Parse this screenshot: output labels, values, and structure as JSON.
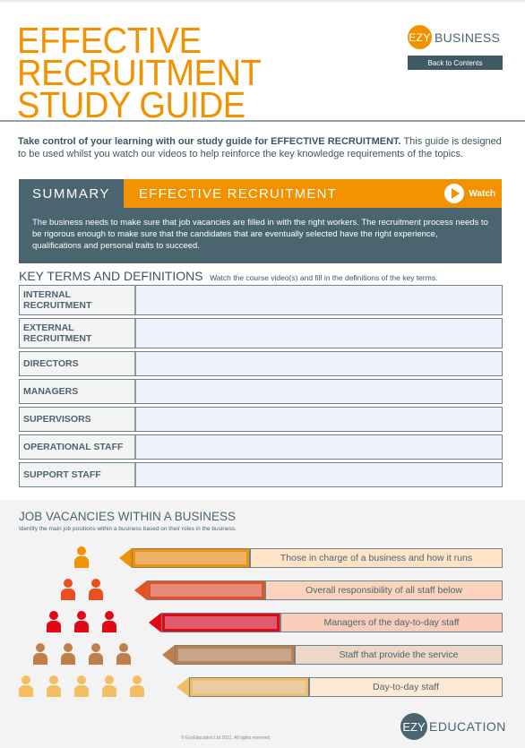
{
  "header": {
    "title_lines": [
      "EFFECTIVE",
      "RECRUITMENT",
      "STUDY GUIDE"
    ],
    "brand_badge": "EZY",
    "brand_name": "BUSINESS",
    "back_button": "Back to Contents"
  },
  "intro": {
    "bold": "Take control of your learning with our study guide for EFFECTIVE RECRUITMENT.",
    "rest": " This guide is designed to be used whilst you watch our videos to help reinforce the key knowledge requirements of the topics."
  },
  "summary": {
    "tab_label": "SUMMARY",
    "heading": "EFFECTIVE RECRUITMENT",
    "watch_label": "Watch",
    "body": "The business needs to make sure that job vacancies are filled in with the right workers. The recruitment process needs to be rigorous enough to make sure that the candidates that are eventually selected have the right experience, qualifications and personal traits to succeed."
  },
  "key_terms": {
    "title": "KEY TERMS AND DEFINITIONS",
    "instruction": "Watch the course video(s) and fill in the definitions of the key terms.",
    "rows": [
      {
        "term": "INTERNAL RECRUITMENT",
        "definition": ""
      },
      {
        "term": "EXTERNAL RECRUITMENT",
        "definition": ""
      },
      {
        "term": "DIRECTORS",
        "definition": ""
      },
      {
        "term": "MANAGERS",
        "definition": ""
      },
      {
        "term": "SUPERVISORS",
        "definition": ""
      },
      {
        "term": "OPERATIONAL STAFF",
        "definition": ""
      },
      {
        "term": "SUPPORT STAFF",
        "definition": ""
      }
    ]
  },
  "job_vacancies": {
    "title": "JOB VACANCIES WITHIN A BUSINESS",
    "subtitle": "Identify the main job positions within a business based on their roles in the business.",
    "levels": [
      {
        "count": 1,
        "color": "#F39200",
        "inner": "#EDB36A",
        "label_bg": "#FEE3C6",
        "description": "Those in charge of a business and how it runs",
        "answer": ""
      },
      {
        "count": 2,
        "color": "#E8501E",
        "inner": "#E58A78",
        "label_bg": "#FCD3BD",
        "description": "Overall responsibility of all staff below",
        "answer": ""
      },
      {
        "count": 3,
        "color": "#E30613",
        "inner": "#E05A6E",
        "label_bg": "#F9CDB9",
        "description": "Managers of the day-to-day staff",
        "answer": ""
      },
      {
        "count": 4,
        "color": "#BF7F4A",
        "inner": "#C9A48C",
        "label_bg": "#EDD7C6",
        "description": "Staff that provide the service",
        "answer": ""
      },
      {
        "count": 5,
        "color": "#F3BD61",
        "inner": "#EBCCA2",
        "label_bg": "#FDE9D4",
        "description": "Day-to-day staff",
        "answer": ""
      }
    ]
  },
  "footer": {
    "copyright": "© EzyEducation Ltd 2021. All rights reserved.",
    "brand_badge": "EZY",
    "brand_name": "EDUCATION"
  }
}
